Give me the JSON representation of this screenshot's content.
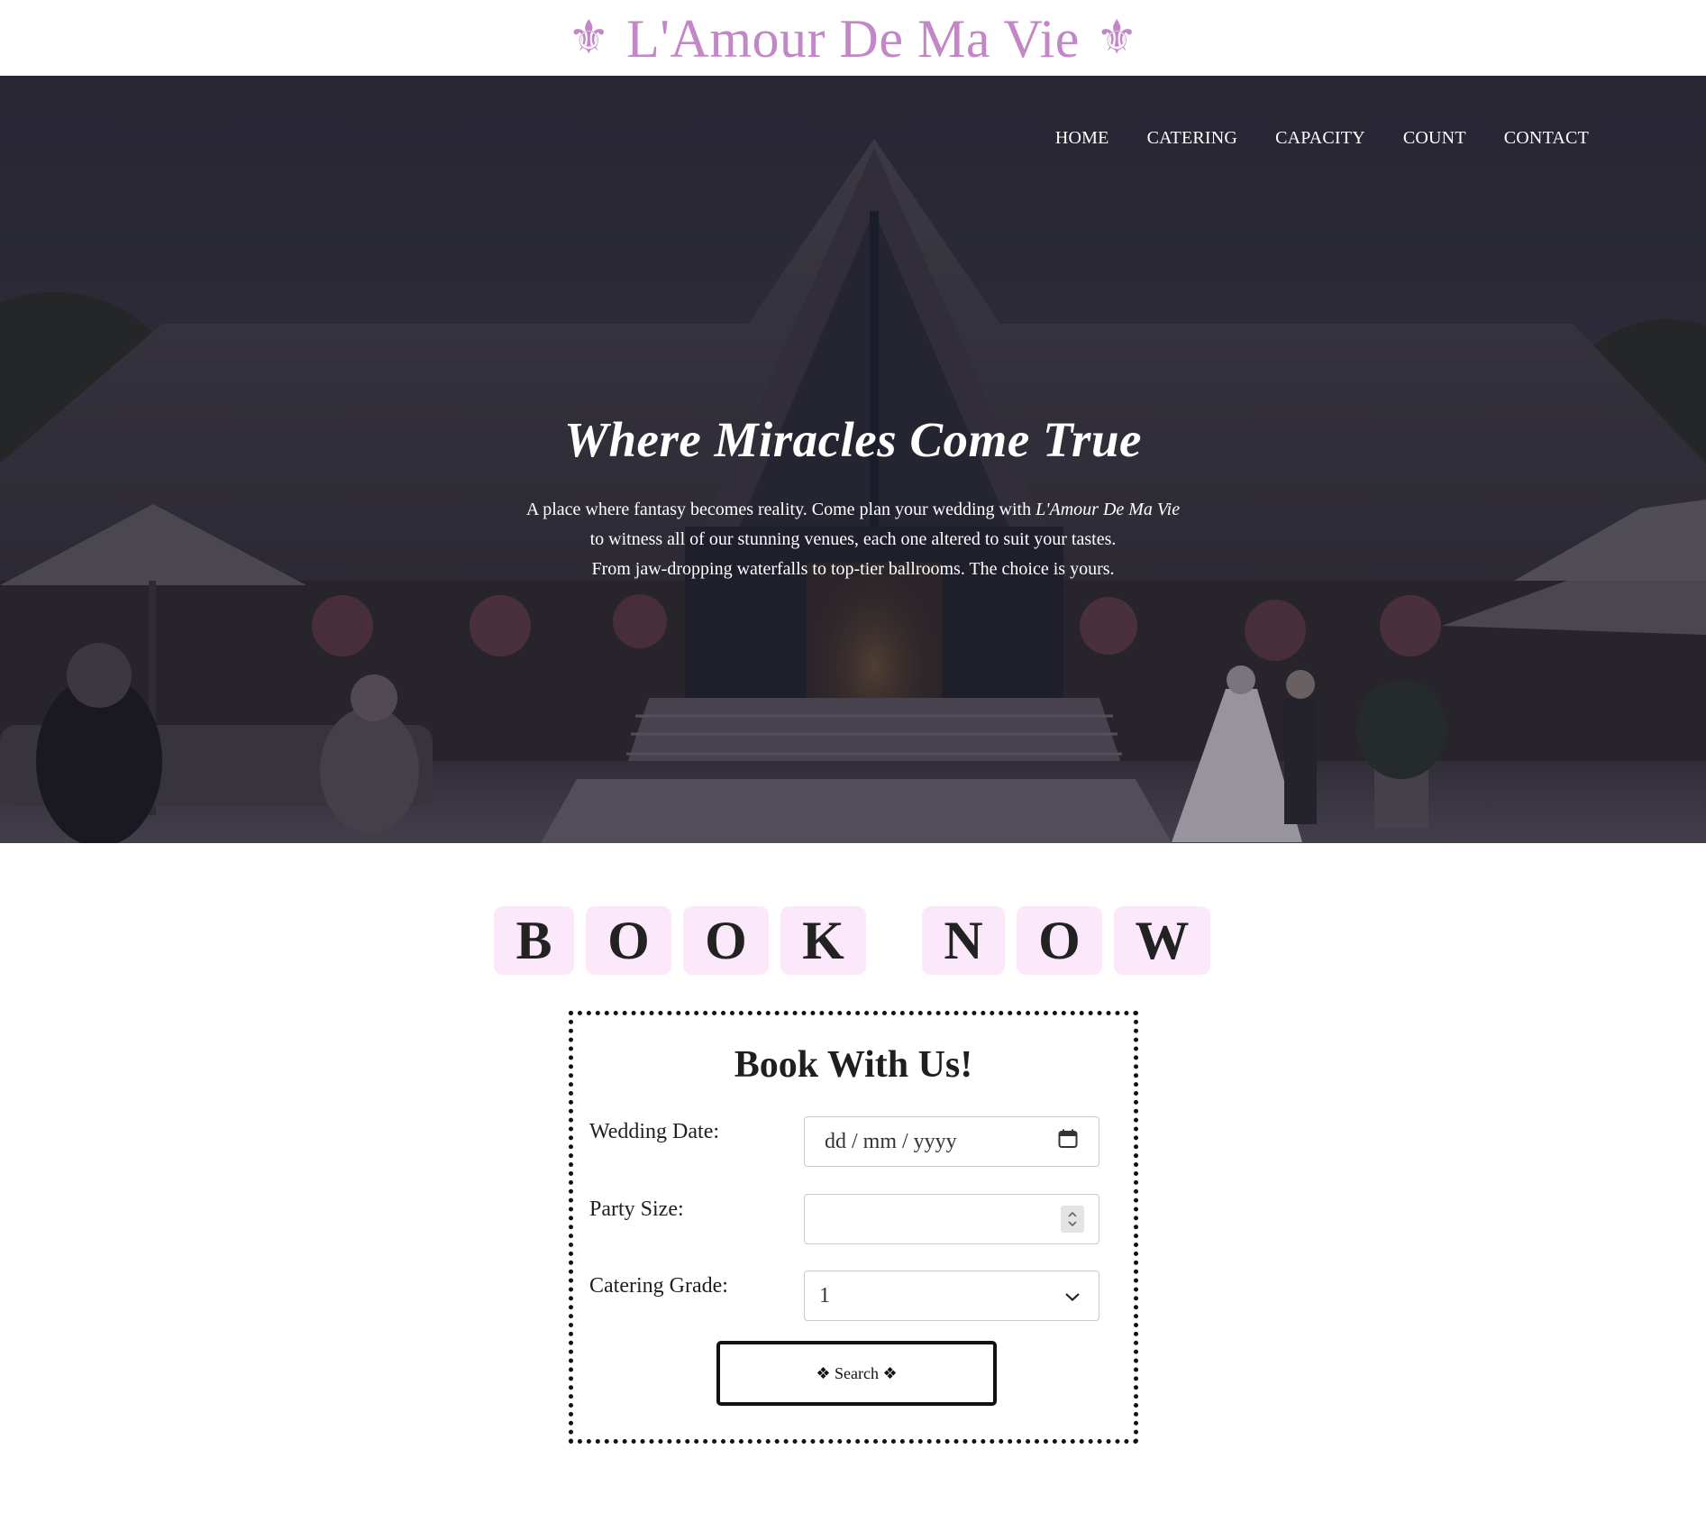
{
  "brand": {
    "name": "L'Amour De Ma Vie",
    "ornament": "⚜",
    "color": "#c287c6"
  },
  "nav": {
    "items": [
      {
        "label": "HOME"
      },
      {
        "label": "CATERING"
      },
      {
        "label": "CAPACITY"
      },
      {
        "label": "COUNT"
      },
      {
        "label": "CONTACT"
      }
    ]
  },
  "hero": {
    "title": "Where Miracles Come True",
    "line1_prefix": "A place where fantasy becomes reality. Come plan your wedding with ",
    "line1_brand": "L'Amour De Ma Vie",
    "line2": "to witness all of our stunning venues, each one altered to suit your tastes.",
    "line3": "From jaw-dropping waterfalls to top-tier ballrooms. The choice is yours."
  },
  "book_now": {
    "letters": [
      "B",
      "O",
      "O",
      "K",
      "N",
      "O",
      "W"
    ],
    "tile_color": "#fbe8fb"
  },
  "booking_form": {
    "title": "Book With Us!",
    "wedding_date_label": "Wedding Date:",
    "wedding_date_placeholder": "dd / mm / yyyy",
    "party_size_label": "Party Size:",
    "party_size_value": "",
    "catering_grade_label": "Catering Grade:",
    "catering_grade_value": "1",
    "search_label": "❖ Search ❖"
  }
}
